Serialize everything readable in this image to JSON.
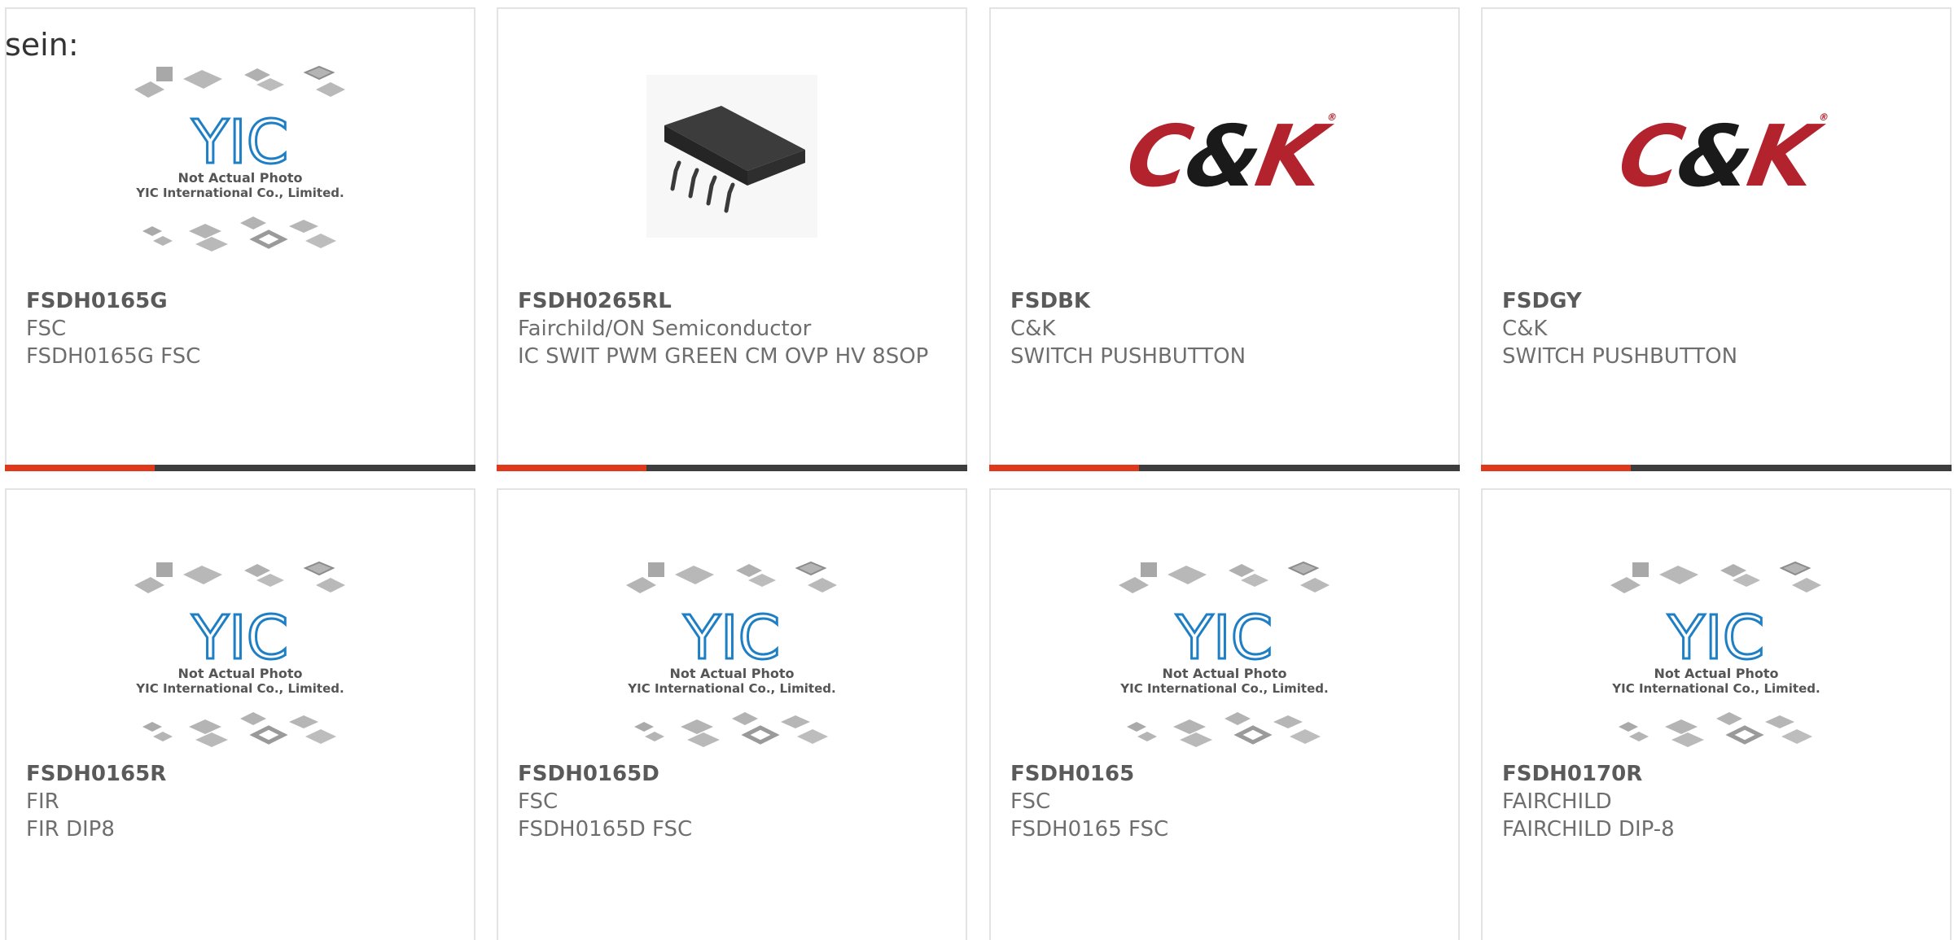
{
  "heading": "sein:",
  "placeholder": {
    "caption_line1": "Not Actual Photo",
    "caption_line2": "YIC International Co., Limited.",
    "logo_text": "YIC"
  },
  "ck_logo": {
    "left": "C",
    "amp": "&",
    "right": "K",
    "tm": "®"
  },
  "colors": {
    "accent": "#e0381b",
    "bar_dark": "#3d3d3d",
    "ck_red": "#b3232d",
    "yic_blue": "#1f7fc4"
  },
  "products": [
    {
      "part": "FSDH0165G",
      "maker": "FSC",
      "desc": "FSDH0165G FSC",
      "image": "placeholder"
    },
    {
      "part": "FSDH0265RL",
      "maker": "Fairchild/ON Semiconductor",
      "desc": "IC SWIT PWM GREEN CM OVP HV 8SOP",
      "image": "chip"
    },
    {
      "part": "FSDBK",
      "maker": "C&K",
      "desc": "SWITCH PUSHBUTTON",
      "image": "ck"
    },
    {
      "part": "FSDGY",
      "maker": "C&K",
      "desc": "SWITCH PUSHBUTTON",
      "image": "ck"
    },
    {
      "part": "FSDH0165R",
      "maker": "FIR",
      "desc": "FIR DIP8",
      "image": "placeholder"
    },
    {
      "part": "FSDH0165D",
      "maker": "FSC",
      "desc": "FSDH0165D FSC",
      "image": "placeholder"
    },
    {
      "part": "FSDH0165",
      "maker": "FSC",
      "desc": "FSDH0165 FSC",
      "image": "placeholder"
    },
    {
      "part": "FSDH0170R",
      "maker": "FAIRCHILD",
      "desc": "FAIRCHILD DIP-8",
      "image": "placeholder"
    }
  ]
}
